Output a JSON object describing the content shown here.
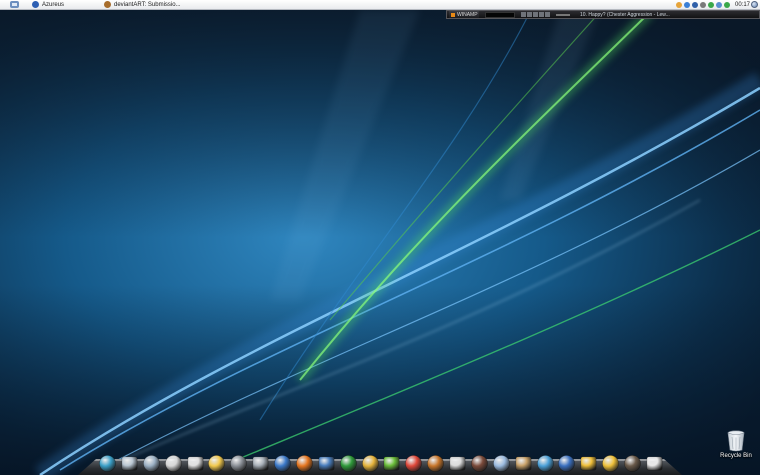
{
  "taskbar": {
    "tasks": [
      {
        "label": "Azureus",
        "icon": "azureus-frog-icon"
      },
      {
        "label": "deviantART: Submissio...",
        "icon": "deviantart-icon"
      }
    ],
    "clock": "00:17"
  },
  "winamp": {
    "logo": "WINAMP",
    "now_playing": "10. Happy? (Chester Aggression - Lew..."
  },
  "desktop": {
    "recycle_bin_label": "Recycle Bin"
  },
  "dock": {
    "items": [
      {
        "name": "desktop-icon",
        "color": "#3aa0c8"
      },
      {
        "name": "folder-icon",
        "color": "#b9c6d2"
      },
      {
        "name": "downloads-folder-icon",
        "color": "#9bb0c4"
      },
      {
        "name": "usb-drive-icon",
        "color": "#d6d6d6"
      },
      {
        "name": "pin-icon",
        "color": "#e0e0e0"
      },
      {
        "name": "folder-yellow-icon",
        "color": "#f2c94c"
      },
      {
        "name": "webcam-icon",
        "color": "#8a8f96"
      },
      {
        "name": "harddrive-icon",
        "color": "#a8b0b8"
      },
      {
        "name": "globe-ie-icon",
        "color": "#3b79c9"
      },
      {
        "name": "firefox-icon",
        "color": "#e6761f"
      },
      {
        "name": "thunderbird-icon",
        "color": "#4a7fbf"
      },
      {
        "name": "utorrent-icon",
        "color": "#2f9a3a"
      },
      {
        "name": "pencil-icon",
        "color": "#e6b43b"
      },
      {
        "name": "msn-messenger-icon",
        "color": "#6bbf3a"
      },
      {
        "name": "media-player-icon",
        "color": "#e0483a"
      },
      {
        "name": "guitar-icon",
        "color": "#c8762a"
      },
      {
        "name": "paint-icon",
        "color": "#dcdcdc"
      },
      {
        "name": "itunes-icon",
        "color": "#7a4a3a"
      },
      {
        "name": "winamp-bolt-icon",
        "color": "#9bbbe0"
      },
      {
        "name": "coliseum-icon",
        "color": "#c9a26a"
      },
      {
        "name": "network-icon",
        "color": "#4aa0d8"
      },
      {
        "name": "xfire-icon",
        "color": "#3a70c0"
      },
      {
        "name": "keys-icon",
        "color": "#f0c03a"
      },
      {
        "name": "game-5-icon",
        "color": "#f0c23a"
      },
      {
        "name": "warrior-game-icon",
        "color": "#6a5a4a"
      },
      {
        "name": "clock-icon",
        "color": "#e8e8e8"
      }
    ]
  }
}
